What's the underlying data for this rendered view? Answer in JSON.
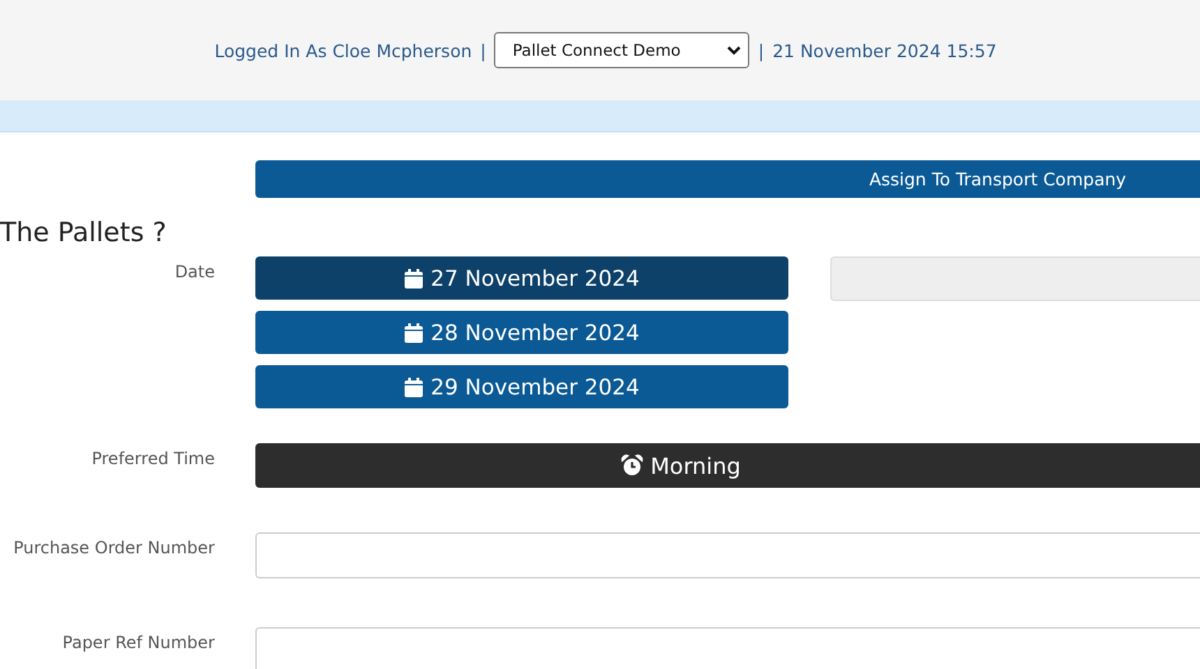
{
  "header": {
    "logged_in": "Logged In As Cloe Mcpherson",
    "separator_left": "|",
    "account_select": {
      "value": "Pallet Connect Demo"
    },
    "separator_right": "|",
    "datetime": "21 November 2024 15:57"
  },
  "assign_button": "Assign To Transport Company",
  "section_title": "The Pallets ?",
  "date_label": "Date",
  "dates": [
    {
      "label": "27 November 2024",
      "selected": true
    },
    {
      "label": "28 November 2024",
      "selected": false
    },
    {
      "label": "29 November 2024",
      "selected": false
    }
  ],
  "time_label": "Preferred Time",
  "time_button": "Morning",
  "fields": [
    {
      "label": "Purchase Order Number"
    },
    {
      "label": "Paper Ref Number"
    }
  ]
}
